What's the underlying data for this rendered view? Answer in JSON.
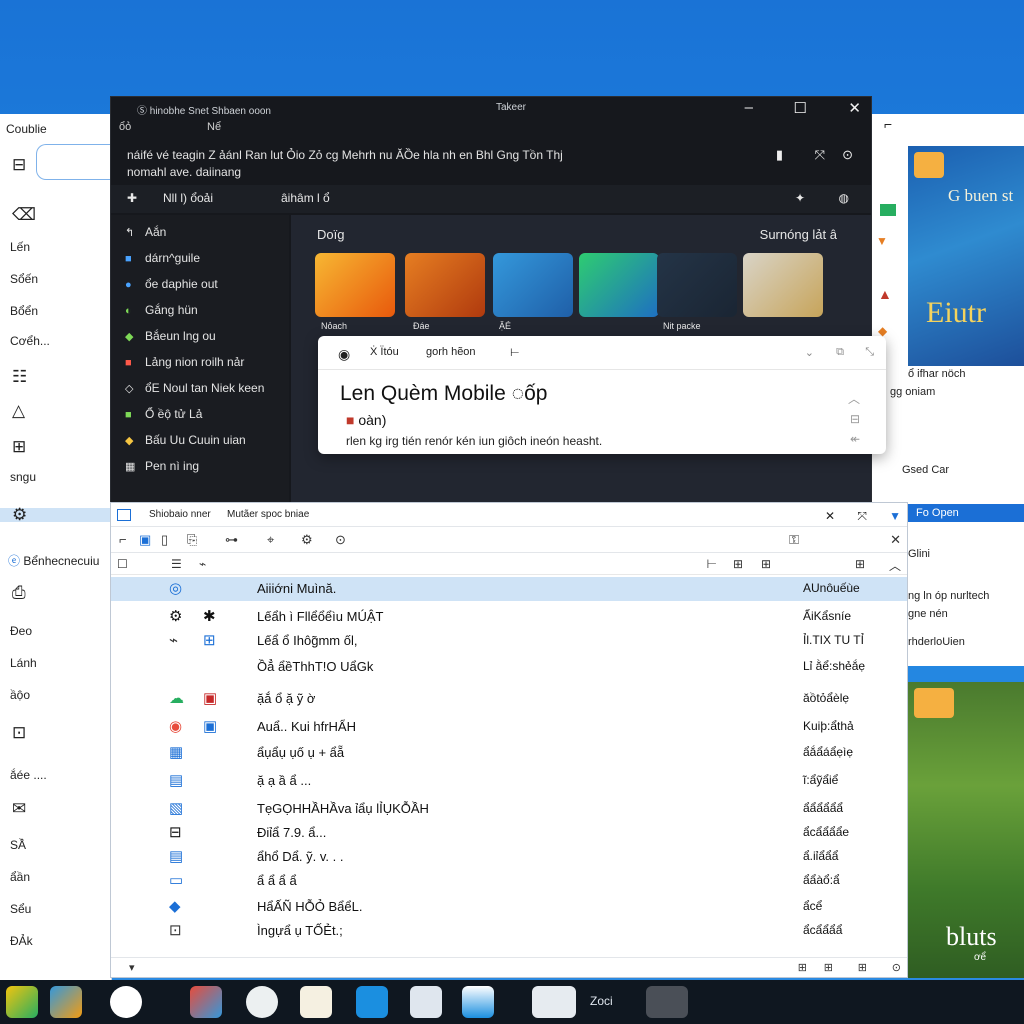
{
  "left_window": {
    "title": "Coublie",
    "items": [
      "Lến",
      "Sổến",
      "Bổển",
      "Cơểh...",
      "sngu",
      "Bểnhecnecuiu",
      "Ðeo",
      "Lánh",
      "ầộo",
      "ắée ....",
      "SẦ",
      "ẩần",
      "Sểu",
      "ÐẢk"
    ]
  },
  "dark_window": {
    "title": "Ⓢ hinobhe Snet Shbaen ooon",
    "center_title": "Takeer",
    "subtitle_left": "ổỏ",
    "subtitle_right": "Nể",
    "command_text": "náifé vé teagin Z ảánl Ran lut Ỏio Zỏ cg Mehrh nu ĂỒe hla nh en Bhl Gng Tồn Thj",
    "command_sub": "nomahl ave.   daiinang",
    "nav_item1": "Nll l) ổoải",
    "nav_item2": "âihâm l ổ",
    "sidebar": [
      {
        "icon": "↰",
        "label": "Aắn"
      },
      {
        "icon": "■",
        "label": "dárn^guile"
      },
      {
        "icon": "●",
        "label": "ổe daphie out"
      },
      {
        "icon": "◐",
        "label": "Gắng hün"
      },
      {
        "icon": "◆",
        "label": "Bắeun lng ou"
      },
      {
        "icon": "■",
        "label": "Lảng nion roilh nảr"
      },
      {
        "icon": "◇",
        "label": "ổE Noul tan Niek keen"
      },
      {
        "icon": "■",
        "label": "Ổ ềộ tử Lả"
      },
      {
        "icon": "◆",
        "label": "Bấu Uu Cuuin uian"
      },
      {
        "icon": "▦",
        "label": "Pen nì ing"
      }
    ],
    "section_left": "Doïg",
    "section_right": "Surnóng lảt â",
    "tiles": [
      {
        "label": "Nỏach",
        "color": "#f39c12"
      },
      {
        "label": "Ðáe",
        "color": "#d35400"
      },
      {
        "label": "ẶÉ",
        "color": "#2e86de"
      },
      {
        "label": "",
        "color": "#27ae60"
      },
      {
        "label": "Nit packe",
        "color": "#2c3e50"
      },
      {
        "label": "",
        "color": "#bdc3c7"
      }
    ]
  },
  "popup": {
    "tab1": "Ẋ Ïtóu",
    "tab2": "gorh hẽon",
    "headline": "Len Quèm  Mobile ◌ốp",
    "sub": "oàn)",
    "desc": "rlen kg irg tién renór kén iun giôch ineón heasht."
  },
  "right_panel": {
    "text1": "ổ ifhar nöch",
    "text2": "gg oniam",
    "image1_text": "G buen st",
    "image1_big": "Eiutr",
    "mid1": "Gsed Car",
    "selected": "Fo Open",
    "mid2": "Glini",
    "mid3": "ng ln óp nurltech",
    "mid4": "gne nén",
    "mid5": "rhderloUien",
    "image2_text": "bluts",
    "image2_sub": "ơể"
  },
  "list_window": {
    "title_left": "Shiobaio nner",
    "title_center": "Mutãer spoc bniae",
    "rows": [
      {
        "name": "Aiiiớni Muìnă.",
        "meta": "AUnôuếùe"
      },
      {
        "name": "Lếẩh ì Fllểổểìu MÚẬT",
        "meta": "ẨiKẩsníe"
      },
      {
        "name": "Lếẩ ổ Ihôg̃mm ốl,",
        "meta": "Ỉl.TIX TU TỈ"
      },
      {
        "name": "Ồẳ ẩềThhT!O UẩGk",
        "meta": "Lỉ ằể:shẻắẹ"
      },
      {
        "name": "ặắ ổ ặ ỹ ờ",
        "meta": "ăồtỏẩèlẹ"
      },
      {
        "name": "Auẩ.. Kui hfrHẨH",
        "meta": "Kuiþ:ẩthả"
      },
      {
        "name": "ẩụẩụ ụố ụ + ẩẵ",
        "meta": "ẩắẩáẩẹìẹ"
      },
      {
        "name": "ặ ạ ầ ẩ ...",
        "meta": "ĩ:ẩỹẩiể"
      },
      {
        "name": "TẹGỌHHẦHẦva ỉẩụ lỈỤKỖẦH",
        "meta": "ẩẩẩẩẩẩ"
      },
      {
        "name": "Ðiỉẩ 7.9. ẩ...",
        "meta": "ẩcẩẩẩẩe"
      },
      {
        "name": "ẩhổ Dẩ. ỹ. v. . .",
        "meta": "ẩ.iỉẩẩẩ"
      },
      {
        "name": "ẩ ẩ ẩ ẩ",
        "meta": "ẩẩàổ:ẩ"
      },
      {
        "name": "HẩẤÑ HỖỎ BẩểL.",
        "meta": "ẩcể"
      },
      {
        "name": "Ìngựẩ ụ TỐẺt.;",
        "meta": "ẩcẩẩẩẩ"
      }
    ]
  },
  "taskbar": {
    "label": "Zoci"
  }
}
